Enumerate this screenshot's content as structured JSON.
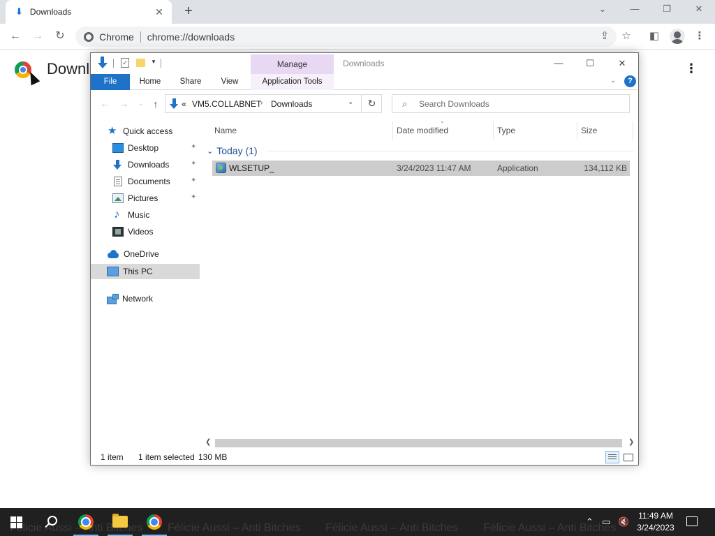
{
  "chrome": {
    "tab_title": "Downloads",
    "omnibox_site_label": "Chrome",
    "omnibox_url": "chrome://downloads",
    "page_title": "Downloads"
  },
  "explorer": {
    "title": "Downloads",
    "manage_tab": "Manage",
    "ribbon_tabs": {
      "file": "File",
      "home": "Home",
      "share": "Share",
      "view": "View",
      "app_tools": "Application Tools"
    },
    "address": {
      "prefix": "«",
      "segment1": "VM5.COLLABNET",
      "segment2": "Downloads"
    },
    "search_placeholder": "Search Downloads",
    "nav": {
      "quick_access": "Quick access",
      "desktop": "Desktop",
      "downloads": "Downloads",
      "documents": "Documents",
      "pictures": "Pictures",
      "music": "Music",
      "videos": "Videos",
      "onedrive": "OneDrive",
      "this_pc": "This PC",
      "network": "Network"
    },
    "columns": {
      "name": "Name",
      "date_modified": "Date modified",
      "type": "Type",
      "size": "Size"
    },
    "group_title": "Today (1)",
    "files": [
      {
        "name": "WLSETUP_",
        "date_modified": "3/24/2023 11:47 AM",
        "type": "Application",
        "size": "134,112 KB"
      }
    ],
    "status": {
      "item_count": "1 item",
      "selected": "1 item selected",
      "selected_size": "130 MB"
    }
  },
  "taskbar": {
    "background_text": "Félicie Aussi – Anti Bitches",
    "time": "11:49 AM",
    "date": "3/24/2023"
  },
  "colors": {
    "accent": "#1e73c8",
    "manage_tab": "#e8d8f3",
    "selected_row": "#cccccc",
    "taskbar": "#202020"
  }
}
